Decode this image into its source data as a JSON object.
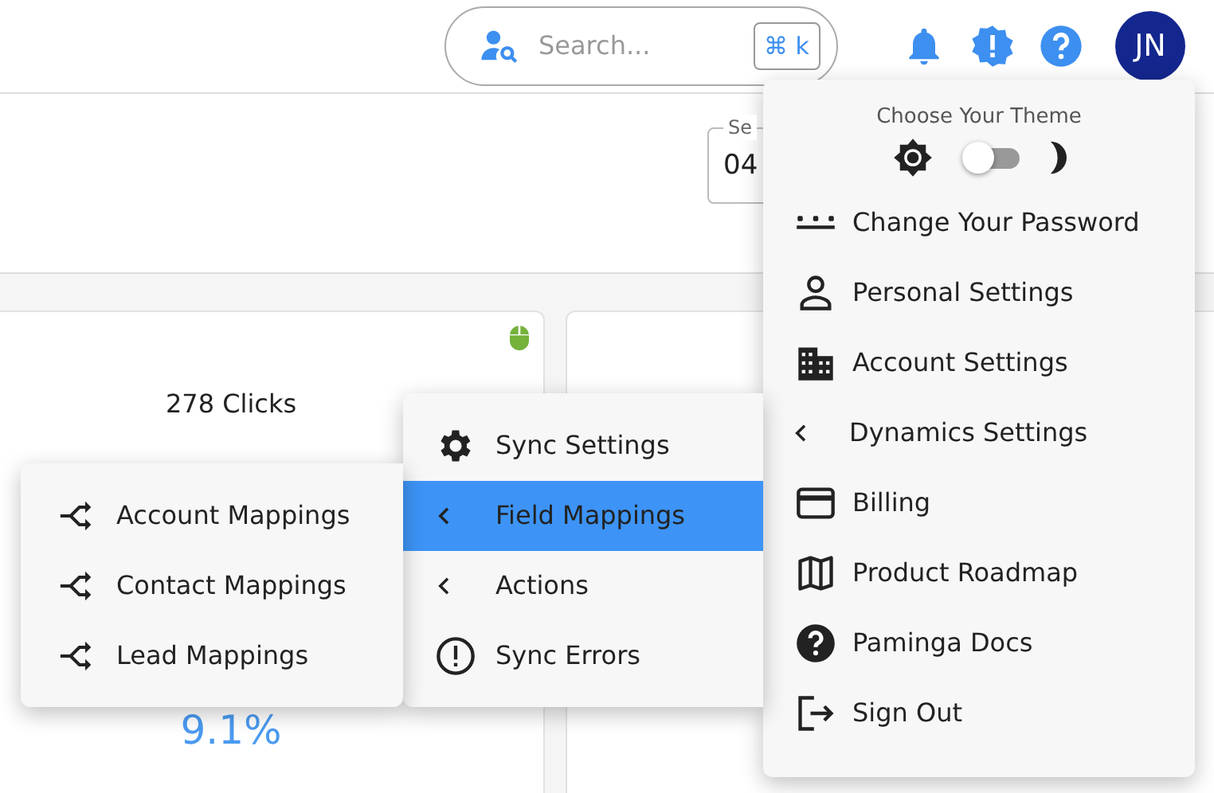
{
  "header": {
    "search": {
      "placeholder": "Search...",
      "shortcut": "⌘ k"
    },
    "avatar": "JN"
  },
  "date_field": {
    "label": "Se",
    "value": "04"
  },
  "cards": [
    {
      "clicks": "278 Clicks",
      "rate2": "9.1%"
    }
  ],
  "user_menu": {
    "theme": {
      "title": "Choose Your Theme",
      "dark_mode": false
    },
    "items": [
      {
        "label": "Change Your Password",
        "kind": "link"
      },
      {
        "label": "Personal Settings",
        "kind": "link"
      },
      {
        "label": "Account Settings",
        "kind": "link"
      },
      {
        "label": "Dynamics Settings",
        "kind": "submenu",
        "expanded": true
      },
      {
        "label": "Billing",
        "kind": "link"
      },
      {
        "label": "Product Roadmap",
        "kind": "link"
      },
      {
        "label": "Paminga Docs",
        "kind": "link"
      },
      {
        "label": "Sign Out",
        "kind": "link"
      }
    ]
  },
  "dynamics_menu": {
    "items": [
      {
        "label": "Sync Settings",
        "kind": "link",
        "selected": false
      },
      {
        "label": "Field Mappings",
        "kind": "submenu",
        "selected": true
      },
      {
        "label": "Actions",
        "kind": "submenu",
        "selected": false
      },
      {
        "label": "Sync Errors",
        "kind": "link",
        "selected": false
      }
    ]
  },
  "mappings_menu": {
    "items": [
      {
        "label": "Account Mappings"
      },
      {
        "label": "Contact Mappings"
      },
      {
        "label": "Lead Mappings"
      }
    ]
  }
}
